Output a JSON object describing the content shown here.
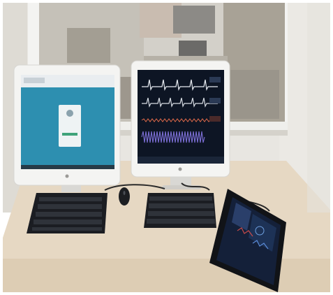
{
  "scene": {
    "description_free": true,
    "colors": {
      "wall": "#e8e6e1",
      "window_frame": "#f3f3f1",
      "glass": "#b9b3a9",
      "desk": "#e6d8c3",
      "desk_edge": "#d8c6ac",
      "monitor_bezel": "#f4f4f2",
      "left_screen_bg": "#2d8fb0",
      "right_screen_bg": "#0d1524",
      "keyboard": "#1b1d22",
      "tablet_screen": "#142039"
    },
    "objects": [
      "left-monitor",
      "right-monitor",
      "left-keyboard",
      "right-keyboard",
      "mouse",
      "tablet",
      "observation-window"
    ]
  }
}
